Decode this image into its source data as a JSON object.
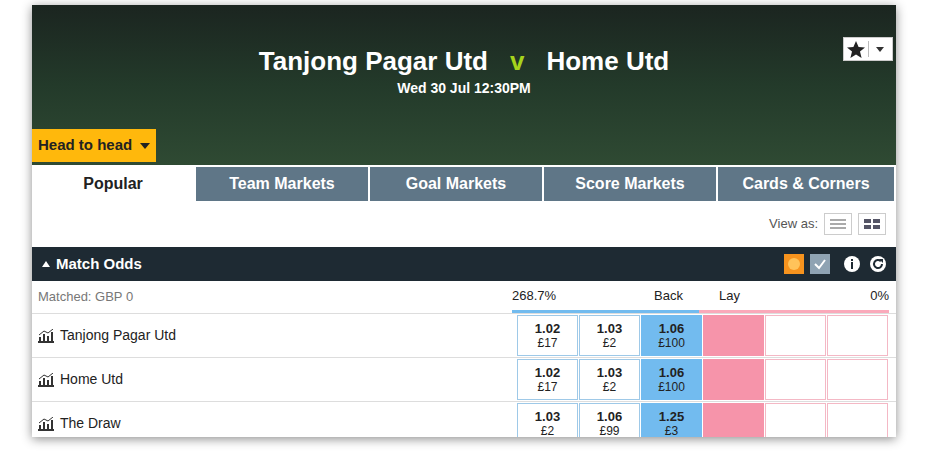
{
  "event": {
    "home": "Tanjong Pagar Utd",
    "separator": "v",
    "away": "Home Utd",
    "time": "Wed 30 Jul 12:30PM"
  },
  "header_button": {
    "label": "Head to head"
  },
  "tabs": [
    {
      "label": "Popular",
      "selected": true
    },
    {
      "label": "Team Markets",
      "selected": false
    },
    {
      "label": "Goal Markets",
      "selected": false
    },
    {
      "label": "Score Markets",
      "selected": false
    },
    {
      "label": "Cards & Corners",
      "selected": false
    }
  ],
  "view_as": {
    "label": "View as:"
  },
  "market": {
    "title": "Match Odds"
  },
  "summary": {
    "matched": "Matched: GBP 0",
    "back_percent": "268.7%",
    "back": "Back",
    "lay": "Lay",
    "lay_percent": "0%"
  },
  "runners": [
    {
      "name": "Tanjong Pagar Utd",
      "back": [
        {
          "odds": "1.02",
          "amount": "£17"
        },
        {
          "odds": "1.03",
          "amount": "£2"
        },
        {
          "odds": "1.06",
          "amount": "£100"
        }
      ]
    },
    {
      "name": "Home Utd",
      "back": [
        {
          "odds": "1.02",
          "amount": "£17"
        },
        {
          "odds": "1.03",
          "amount": "£2"
        },
        {
          "odds": "1.06",
          "amount": "£100"
        }
      ]
    },
    {
      "name": "The Draw",
      "back": [
        {
          "odds": "1.03",
          "amount": "£2"
        },
        {
          "odds": "1.06",
          "amount": "£99"
        },
        {
          "odds": "1.25",
          "amount": "£3"
        }
      ]
    }
  ]
}
